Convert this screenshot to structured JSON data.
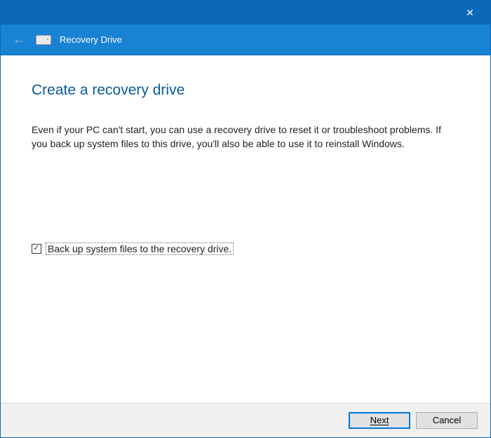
{
  "titlebar": {
    "close_glyph": "✕"
  },
  "subheader": {
    "back_glyph": "←",
    "title": "Recovery Drive"
  },
  "content": {
    "heading": "Create a recovery drive",
    "description": "Even if your PC can't start, you can use a recovery drive to reset it or troubleshoot problems. If you back up system files to this drive, you'll also be able to use it to reinstall Windows.",
    "checkbox": {
      "checked_glyph": "✓",
      "label": "Back up system files to the recovery drive."
    }
  },
  "footer": {
    "next": "Next",
    "cancel": "Cancel"
  }
}
